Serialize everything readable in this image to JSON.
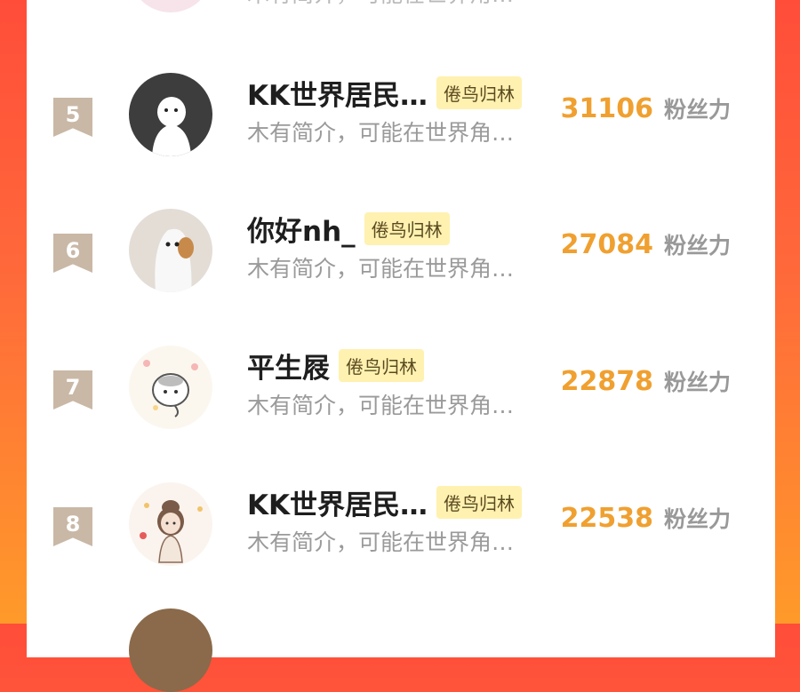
{
  "top_partial_text": "木有简介，可能在世界角…",
  "rows": [
    {
      "rank": "5",
      "name": "KK世界居民…",
      "badge": "倦鸟归林",
      "intro": "木有简介，可能在世界角…",
      "score": "31106",
      "unit": "粉丝力",
      "avatar_icon": "ghost-avatar-icon"
    },
    {
      "rank": "6",
      "name": "你好nh_",
      "badge": "倦鸟归林",
      "intro": "木有简介，可能在世界角…",
      "score": "27084",
      "unit": "粉丝力",
      "avatar_icon": "sheet-dog-avatar-icon"
    },
    {
      "rank": "7",
      "name": "平生屐",
      "badge": "倦鸟归林",
      "intro": "木有简介，可能在世界角…",
      "score": "22878",
      "unit": "粉丝力",
      "avatar_icon": "hamster-avatar-icon"
    },
    {
      "rank": "8",
      "name": "KK世界居民…",
      "badge": "倦鸟归林",
      "intro": "木有简介，可能在世界角…",
      "score": "22538",
      "unit": "粉丝力",
      "avatar_icon": "girl-avatar-icon"
    }
  ],
  "colors": {
    "accent": "#f0a030",
    "badge_bg": "#fff1b0",
    "rank_bg": "#c9b8a6"
  }
}
